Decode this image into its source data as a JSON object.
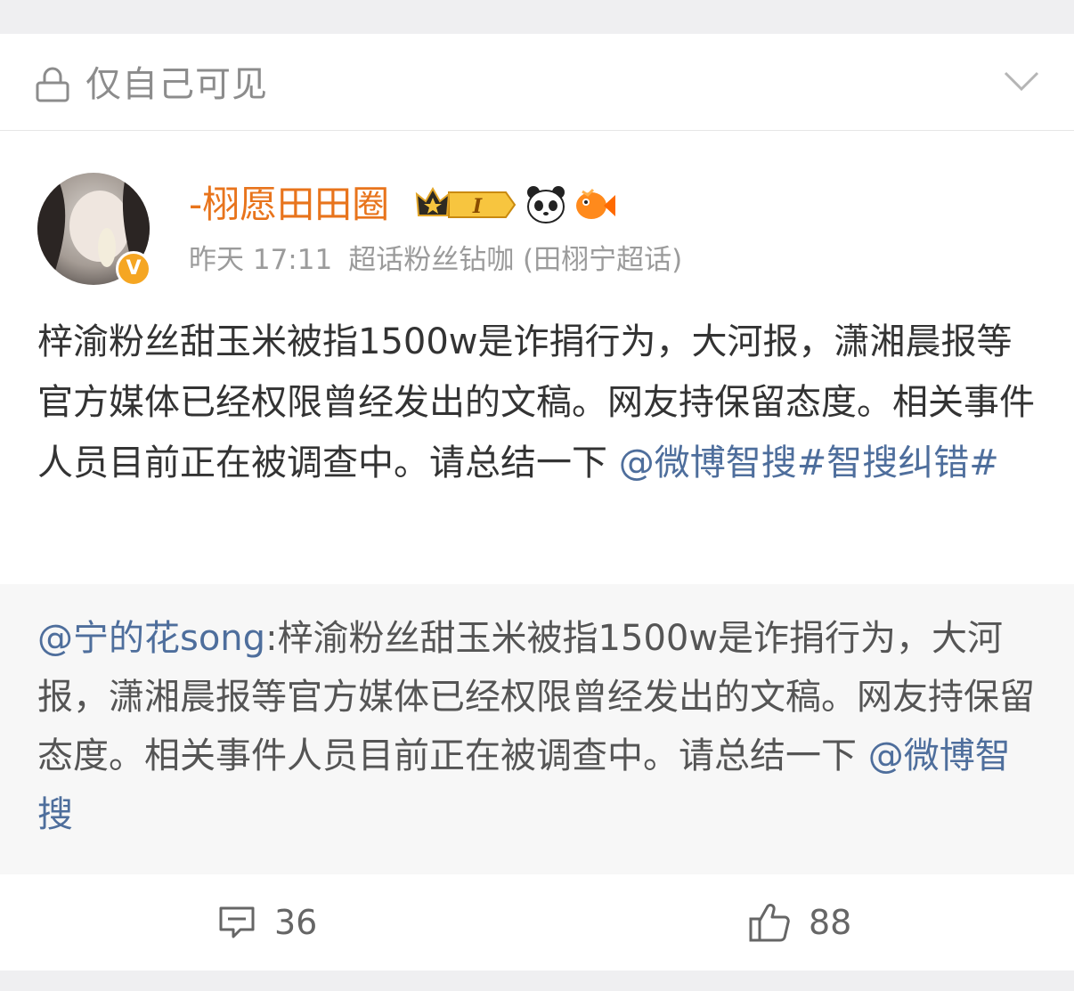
{
  "privacy": {
    "label": "仅自己可见",
    "icon": "lock-icon",
    "toggle_icon": "chevron-down-icon"
  },
  "author": {
    "name": "-栩愿田田圈",
    "avatar_icon": "avatar",
    "verified_icon": "orange-verified-icon",
    "verified_glyph": "V",
    "vip_icon": "vip-crown-badge",
    "vip_level": "I",
    "badge_icons": [
      "panda-icon",
      "fish-icon"
    ]
  },
  "meta": {
    "time": "昨天 17:11",
    "source": "超话粉丝钻咖 (田栩宁超话)"
  },
  "post": {
    "text": "梓渝粉丝甜玉米被指1500w是诈捐行为，大河报，潇湘晨报等官方媒体已经权限曾经发出的文稿。网友持保留态度。相关事件人员目前正在被调查中。请总结一下 ",
    "mention": "@微博智搜",
    "hashtag": "#智搜纠错#"
  },
  "quote": {
    "author": "@宁的花song",
    "separator": ":",
    "text": "梓渝粉丝甜玉米被指1500w是诈捐行为，大河报，潇湘晨报等官方媒体已经权限曾经发出的文稿。网友持保留态度。相关事件人员目前正在被调查中。请总结一下 ",
    "mention": "@微博智搜"
  },
  "actions": {
    "comments": "36",
    "likes": "88",
    "comment_icon": "comment-icon",
    "like_icon": "thumbs-up-icon"
  },
  "colors": {
    "username": "#e8741c",
    "link": "#4e6e9c",
    "body_text": "#333333",
    "meta_text": "#9b9b9b",
    "quote_bg": "#f7f7f7"
  }
}
